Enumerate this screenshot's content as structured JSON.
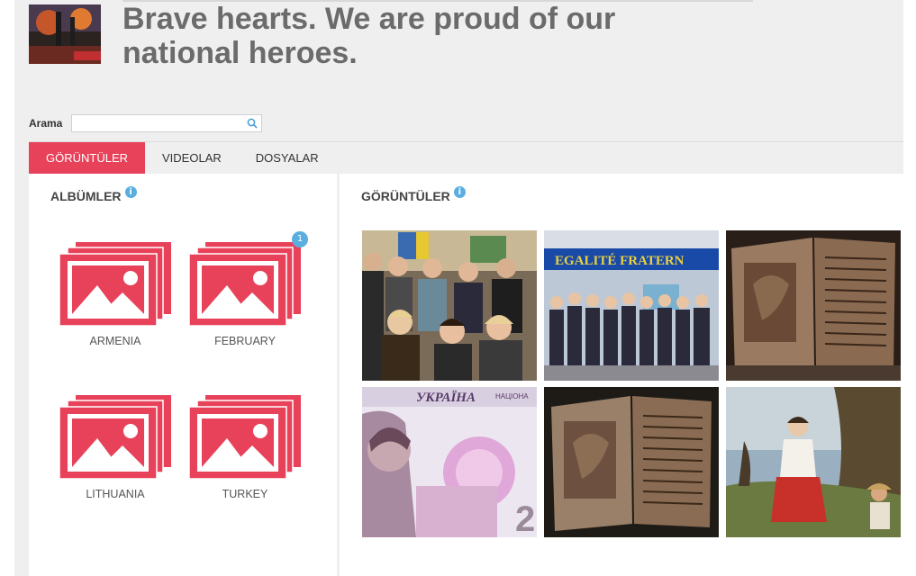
{
  "header": {
    "title_line1": "Brave hearts. We are proud of our",
    "title_line2": "national heroes."
  },
  "search": {
    "label": "Arama",
    "value": "",
    "placeholder": ""
  },
  "tabs": [
    {
      "label": "GÖRÜNTÜLER",
      "active": true
    },
    {
      "label": "VIDEOLAR",
      "active": false
    },
    {
      "label": "DOSYALAR",
      "active": false
    }
  ],
  "albums_panel": {
    "title": "ALBÜMLER",
    "info": "i",
    "items": [
      {
        "label": "ARMENIA"
      },
      {
        "label": "FEBRUARY",
        "badge": "1"
      },
      {
        "label": "LITHUANIA"
      },
      {
        "label": "TURKEY"
      }
    ]
  },
  "images_panel": {
    "title": "GÖRÜNTÜLER",
    "info": "i",
    "thumb_texts": {
      "banner": "EGALITÉ FRATERN",
      "banknote": "УКРАЇНА",
      "banknote_small": "НАЦІОНА",
      "banknote_num": "2"
    }
  },
  "colors": {
    "accent": "#e8425a",
    "info": "#5aaee0",
    "title": "#6b6b6b"
  }
}
